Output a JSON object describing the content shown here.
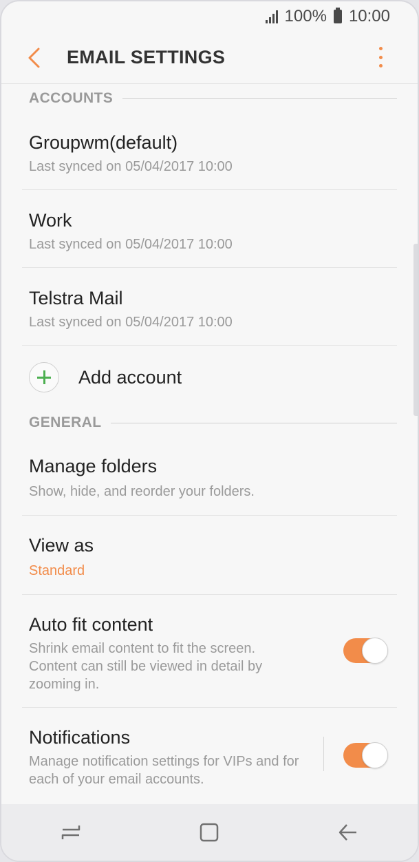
{
  "status_bar": {
    "battery": "100%",
    "time": "10:00"
  },
  "app_bar": {
    "title": "EMAIL SETTINGS"
  },
  "accounts_section": {
    "header": "ACCOUNTS",
    "items": [
      {
        "name": "Groupwm(default)",
        "sync": "Last synced on 05/04/2017  10:00"
      },
      {
        "name": "Work",
        "sync": "Last synced on 05/04/2017  10:00"
      },
      {
        "name": "Telstra Mail",
        "sync": "Last synced on 05/04/2017  10:00"
      }
    ],
    "add_label": "Add account"
  },
  "general_section": {
    "header": "GENERAL",
    "manage_folders": {
      "title": "Manage folders",
      "subtitle": "Show, hide, and reorder your folders."
    },
    "view_as": {
      "title": "View as",
      "value": "Standard"
    },
    "auto_fit": {
      "title": "Auto fit content",
      "subtitle": "Shrink email content to fit the screen. Content can still be viewed in detail by zooming in.",
      "enabled": true
    },
    "notifications": {
      "title": "Notifications",
      "subtitle": "Manage notification settings for VIPs and for each of your email accounts.",
      "enabled": true
    }
  },
  "colors": {
    "accent": "#f28c4a",
    "add_icon": "#4caf50"
  },
  "icons": [
    "signal-icon",
    "battery-icon",
    "back-arrow-icon",
    "more-options-icon",
    "add-icon",
    "recent-apps-icon",
    "home-icon",
    "back-icon"
  ]
}
